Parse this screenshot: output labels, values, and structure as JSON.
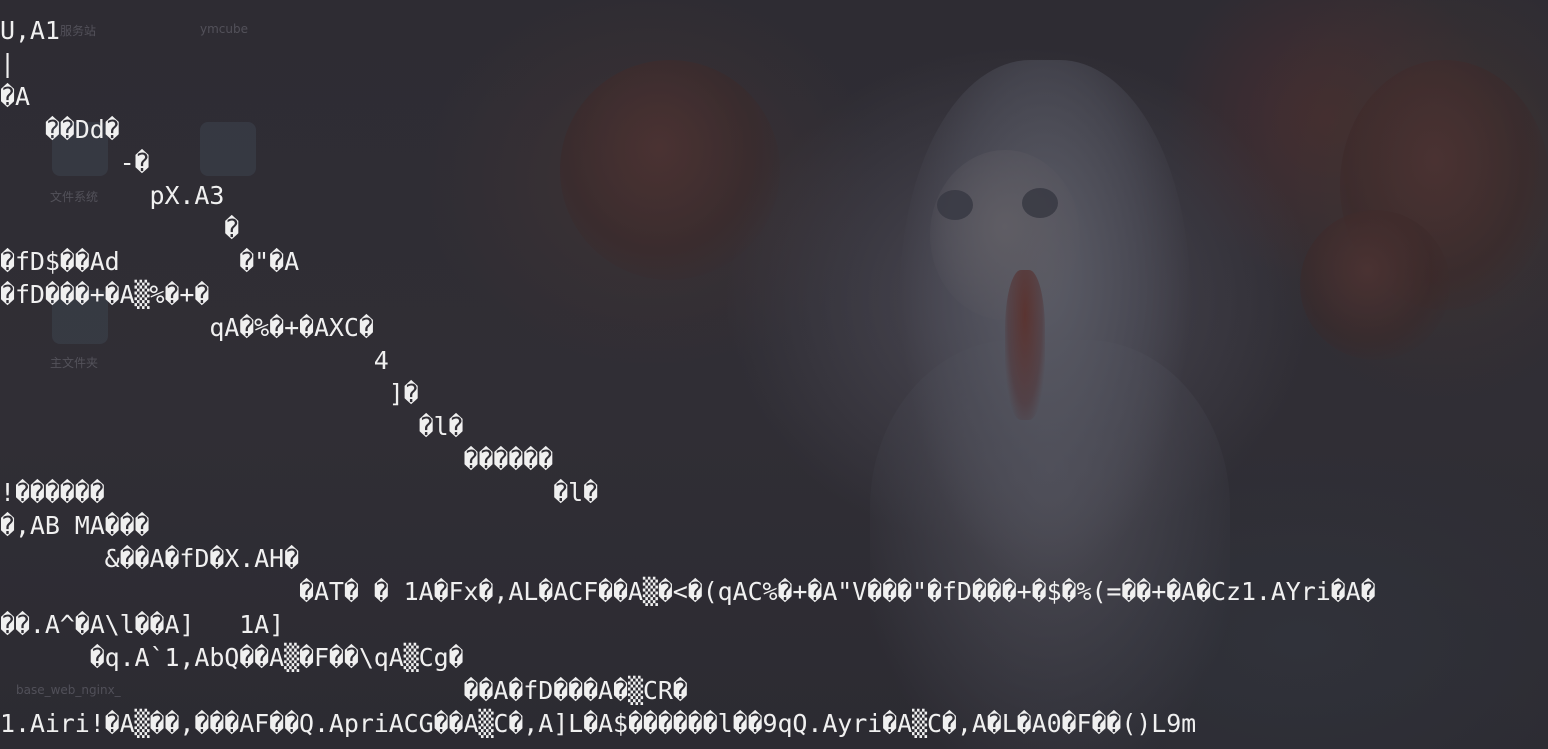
{
  "desktop": {
    "icon_labels": [
      "服务站",
      "ymcube",
      "文件系统",
      "主文件夹",
      "base_web_nginx_"
    ]
  },
  "terminal": {
    "lines": [
      "U,A1",
      "|",
      "�A",
      "   ��Dd�",
      "        -�",
      "          pX.A3",
      "               �",
      "�fD$��Ad        �\"�A",
      "�fD���+�A▒%�+�",
      "              qA�%�+�AXC�",
      "                         4",
      "                          ]�",
      "                            �l�",
      "                               ������",
      "!������                              �l�",
      "�,AB MA���",
      "       &��A�fD�X.AH�",
      "                    �AT� � 1A�Fx�,AL�ACF��A▒�<�(qAC%�+�A\"V���\"�fD���+�$�%(=��+�A�Cz1.AYri�A�",
      "��.A^�A\\l��A]   1A]",
      "      �q.A`1,AbQ��A▒�F��\\qA▒Cg�",
      "                               ��A�fD���A�▒CR�",
      "1.Airi!�A▒��,���AF��Q.ApriACG��A▒C�,A]L�A$������l��9qQ.Ayri�A▒C�,A�L�A0�F��()L9m"
    ]
  }
}
